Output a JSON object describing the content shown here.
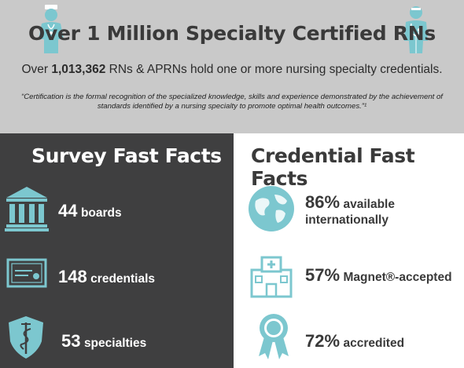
{
  "header": {
    "title": "Over 1 Million Specialty Certified RNs",
    "subline_prefix": "Over ",
    "subline_number": "1,013,362",
    "subline_suffix": " RNs & APRNs hold one or more nursing specialty credentials.",
    "quote": "“Certification is the formal recognition of the specialized knowledge, skills and experience demonstrated by the achievement of standards identified by a nursing specialty to promote optimal health outcomes.”¹"
  },
  "survey": {
    "title": "Survey Fast Facts",
    "facts": [
      {
        "number": "44",
        "label": "boards",
        "icon": "building-icon"
      },
      {
        "number": "148",
        "label": "credentials",
        "icon": "certificate-icon"
      },
      {
        "number": "53",
        "label": "specialties",
        "icon": "caduceus-shield-icon"
      }
    ]
  },
  "credential": {
    "title": "Credential Fast Facts",
    "facts": [
      {
        "number": "86%",
        "label": "available",
        "label2": "internationally",
        "icon": "globe-icon"
      },
      {
        "number": "57%",
        "label": "Magnet®-accepted",
        "icon": "hospital-icon"
      },
      {
        "number": "72%",
        "label": "accredited",
        "icon": "ribbon-award-icon"
      }
    ]
  },
  "colors": {
    "teal": "#7cc7cf",
    "dark_panel": "#3f3f40",
    "header_bg": "#c9c9c9"
  }
}
